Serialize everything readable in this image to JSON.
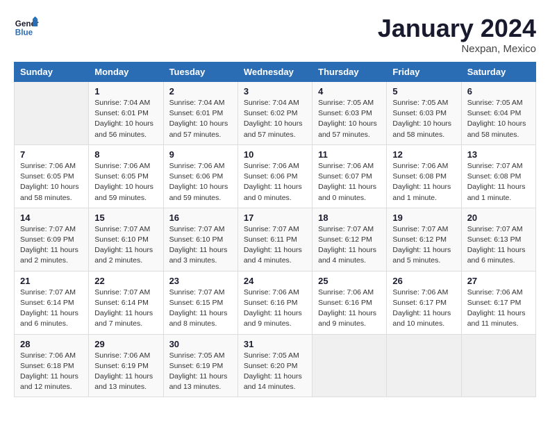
{
  "header": {
    "logo_text_general": "General",
    "logo_text_blue": "Blue",
    "month_title": "January 2024",
    "subtitle": "Nexpan, Mexico"
  },
  "weekdays": [
    "Sunday",
    "Monday",
    "Tuesday",
    "Wednesday",
    "Thursday",
    "Friday",
    "Saturday"
  ],
  "weeks": [
    [
      {
        "day": "",
        "empty": true
      },
      {
        "day": "1",
        "sunrise": "Sunrise: 7:04 AM",
        "sunset": "Sunset: 6:01 PM",
        "daylight": "Daylight: 10 hours and 56 minutes."
      },
      {
        "day": "2",
        "sunrise": "Sunrise: 7:04 AM",
        "sunset": "Sunset: 6:01 PM",
        "daylight": "Daylight: 10 hours and 57 minutes."
      },
      {
        "day": "3",
        "sunrise": "Sunrise: 7:04 AM",
        "sunset": "Sunset: 6:02 PM",
        "daylight": "Daylight: 10 hours and 57 minutes."
      },
      {
        "day": "4",
        "sunrise": "Sunrise: 7:05 AM",
        "sunset": "Sunset: 6:03 PM",
        "daylight": "Daylight: 10 hours and 57 minutes."
      },
      {
        "day": "5",
        "sunrise": "Sunrise: 7:05 AM",
        "sunset": "Sunset: 6:03 PM",
        "daylight": "Daylight: 10 hours and 58 minutes."
      },
      {
        "day": "6",
        "sunrise": "Sunrise: 7:05 AM",
        "sunset": "Sunset: 6:04 PM",
        "daylight": "Daylight: 10 hours and 58 minutes."
      }
    ],
    [
      {
        "day": "7",
        "sunrise": "Sunrise: 7:06 AM",
        "sunset": "Sunset: 6:05 PM",
        "daylight": "Daylight: 10 hours and 58 minutes."
      },
      {
        "day": "8",
        "sunrise": "Sunrise: 7:06 AM",
        "sunset": "Sunset: 6:05 PM",
        "daylight": "Daylight: 10 hours and 59 minutes."
      },
      {
        "day": "9",
        "sunrise": "Sunrise: 7:06 AM",
        "sunset": "Sunset: 6:06 PM",
        "daylight": "Daylight: 10 hours and 59 minutes."
      },
      {
        "day": "10",
        "sunrise": "Sunrise: 7:06 AM",
        "sunset": "Sunset: 6:06 PM",
        "daylight": "Daylight: 11 hours and 0 minutes."
      },
      {
        "day": "11",
        "sunrise": "Sunrise: 7:06 AM",
        "sunset": "Sunset: 6:07 PM",
        "daylight": "Daylight: 11 hours and 0 minutes."
      },
      {
        "day": "12",
        "sunrise": "Sunrise: 7:06 AM",
        "sunset": "Sunset: 6:08 PM",
        "daylight": "Daylight: 11 hours and 1 minute."
      },
      {
        "day": "13",
        "sunrise": "Sunrise: 7:07 AM",
        "sunset": "Sunset: 6:08 PM",
        "daylight": "Daylight: 11 hours and 1 minute."
      }
    ],
    [
      {
        "day": "14",
        "sunrise": "Sunrise: 7:07 AM",
        "sunset": "Sunset: 6:09 PM",
        "daylight": "Daylight: 11 hours and 2 minutes."
      },
      {
        "day": "15",
        "sunrise": "Sunrise: 7:07 AM",
        "sunset": "Sunset: 6:10 PM",
        "daylight": "Daylight: 11 hours and 2 minutes."
      },
      {
        "day": "16",
        "sunrise": "Sunrise: 7:07 AM",
        "sunset": "Sunset: 6:10 PM",
        "daylight": "Daylight: 11 hours and 3 minutes."
      },
      {
        "day": "17",
        "sunrise": "Sunrise: 7:07 AM",
        "sunset": "Sunset: 6:11 PM",
        "daylight": "Daylight: 11 hours and 4 minutes."
      },
      {
        "day": "18",
        "sunrise": "Sunrise: 7:07 AM",
        "sunset": "Sunset: 6:12 PM",
        "daylight": "Daylight: 11 hours and 4 minutes."
      },
      {
        "day": "19",
        "sunrise": "Sunrise: 7:07 AM",
        "sunset": "Sunset: 6:12 PM",
        "daylight": "Daylight: 11 hours and 5 minutes."
      },
      {
        "day": "20",
        "sunrise": "Sunrise: 7:07 AM",
        "sunset": "Sunset: 6:13 PM",
        "daylight": "Daylight: 11 hours and 6 minutes."
      }
    ],
    [
      {
        "day": "21",
        "sunrise": "Sunrise: 7:07 AM",
        "sunset": "Sunset: 6:14 PM",
        "daylight": "Daylight: 11 hours and 6 minutes."
      },
      {
        "day": "22",
        "sunrise": "Sunrise: 7:07 AM",
        "sunset": "Sunset: 6:14 PM",
        "daylight": "Daylight: 11 hours and 7 minutes."
      },
      {
        "day": "23",
        "sunrise": "Sunrise: 7:07 AM",
        "sunset": "Sunset: 6:15 PM",
        "daylight": "Daylight: 11 hours and 8 minutes."
      },
      {
        "day": "24",
        "sunrise": "Sunrise: 7:06 AM",
        "sunset": "Sunset: 6:16 PM",
        "daylight": "Daylight: 11 hours and 9 minutes."
      },
      {
        "day": "25",
        "sunrise": "Sunrise: 7:06 AM",
        "sunset": "Sunset: 6:16 PM",
        "daylight": "Daylight: 11 hours and 9 minutes."
      },
      {
        "day": "26",
        "sunrise": "Sunrise: 7:06 AM",
        "sunset": "Sunset: 6:17 PM",
        "daylight": "Daylight: 11 hours and 10 minutes."
      },
      {
        "day": "27",
        "sunrise": "Sunrise: 7:06 AM",
        "sunset": "Sunset: 6:17 PM",
        "daylight": "Daylight: 11 hours and 11 minutes."
      }
    ],
    [
      {
        "day": "28",
        "sunrise": "Sunrise: 7:06 AM",
        "sunset": "Sunset: 6:18 PM",
        "daylight": "Daylight: 11 hours and 12 minutes."
      },
      {
        "day": "29",
        "sunrise": "Sunrise: 7:06 AM",
        "sunset": "Sunset: 6:19 PM",
        "daylight": "Daylight: 11 hours and 13 minutes."
      },
      {
        "day": "30",
        "sunrise": "Sunrise: 7:05 AM",
        "sunset": "Sunset: 6:19 PM",
        "daylight": "Daylight: 11 hours and 13 minutes."
      },
      {
        "day": "31",
        "sunrise": "Sunrise: 7:05 AM",
        "sunset": "Sunset: 6:20 PM",
        "daylight": "Daylight: 11 hours and 14 minutes."
      },
      {
        "day": "",
        "empty": true
      },
      {
        "day": "",
        "empty": true
      },
      {
        "day": "",
        "empty": true
      }
    ]
  ]
}
